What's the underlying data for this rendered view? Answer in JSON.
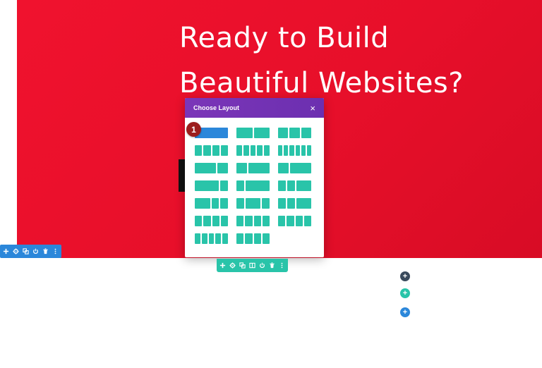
{
  "hero": {
    "headline": "Ready to Build\nBeautiful Websites?",
    "background_color": "#e70f2a"
  },
  "section_toolbar": {
    "color": "#2b87da",
    "icons": [
      "add-icon",
      "gear-icon",
      "duplicate-icon",
      "power-icon",
      "trash-icon",
      "more-icon"
    ]
  },
  "row_toolbar": {
    "color": "#29c4a9",
    "icons": [
      "add-icon",
      "gear-icon",
      "duplicate-icon",
      "columns-icon",
      "power-icon",
      "trash-icon",
      "more-icon"
    ]
  },
  "layout_modal": {
    "title": "Choose Layout",
    "close_symbol": "×",
    "header_color": "#6c2fb0",
    "option_color": "#29c4a9",
    "selected_color": "#2b87da",
    "selected_badge": "1",
    "layouts": [
      [
        [
          1
        ],
        [
          1,
          1
        ],
        [
          1,
          1,
          1
        ]
      ],
      [
        [
          1,
          1,
          1,
          1
        ],
        [
          1,
          1,
          1,
          1,
          1
        ],
        [
          1,
          1,
          1,
          1,
          1,
          1
        ]
      ],
      [
        [
          2,
          1
        ],
        [
          1,
          2
        ],
        [
          1,
          2
        ]
      ],
      [
        [
          3,
          1
        ],
        [
          1,
          3
        ],
        [
          1,
          1,
          2
        ]
      ],
      [
        [
          2,
          1,
          1
        ],
        [
          1,
          2,
          1
        ],
        [
          1,
          1,
          2
        ]
      ],
      [
        [
          1,
          1,
          1,
          1
        ],
        [
          1,
          1,
          1,
          1
        ],
        [
          1,
          1,
          1,
          1
        ]
      ],
      [
        [
          1,
          1,
          1,
          1,
          1
        ],
        [
          1,
          1,
          1,
          1
        ]
      ]
    ]
  },
  "add_buttons": [
    {
      "name": "add-section-button",
      "color": "#3a4a5c",
      "symbol": "+"
    },
    {
      "name": "add-row-button",
      "color": "#29c4a9",
      "symbol": "+"
    },
    {
      "name": "add-module-button",
      "color": "#2b87da",
      "symbol": "+"
    }
  ]
}
